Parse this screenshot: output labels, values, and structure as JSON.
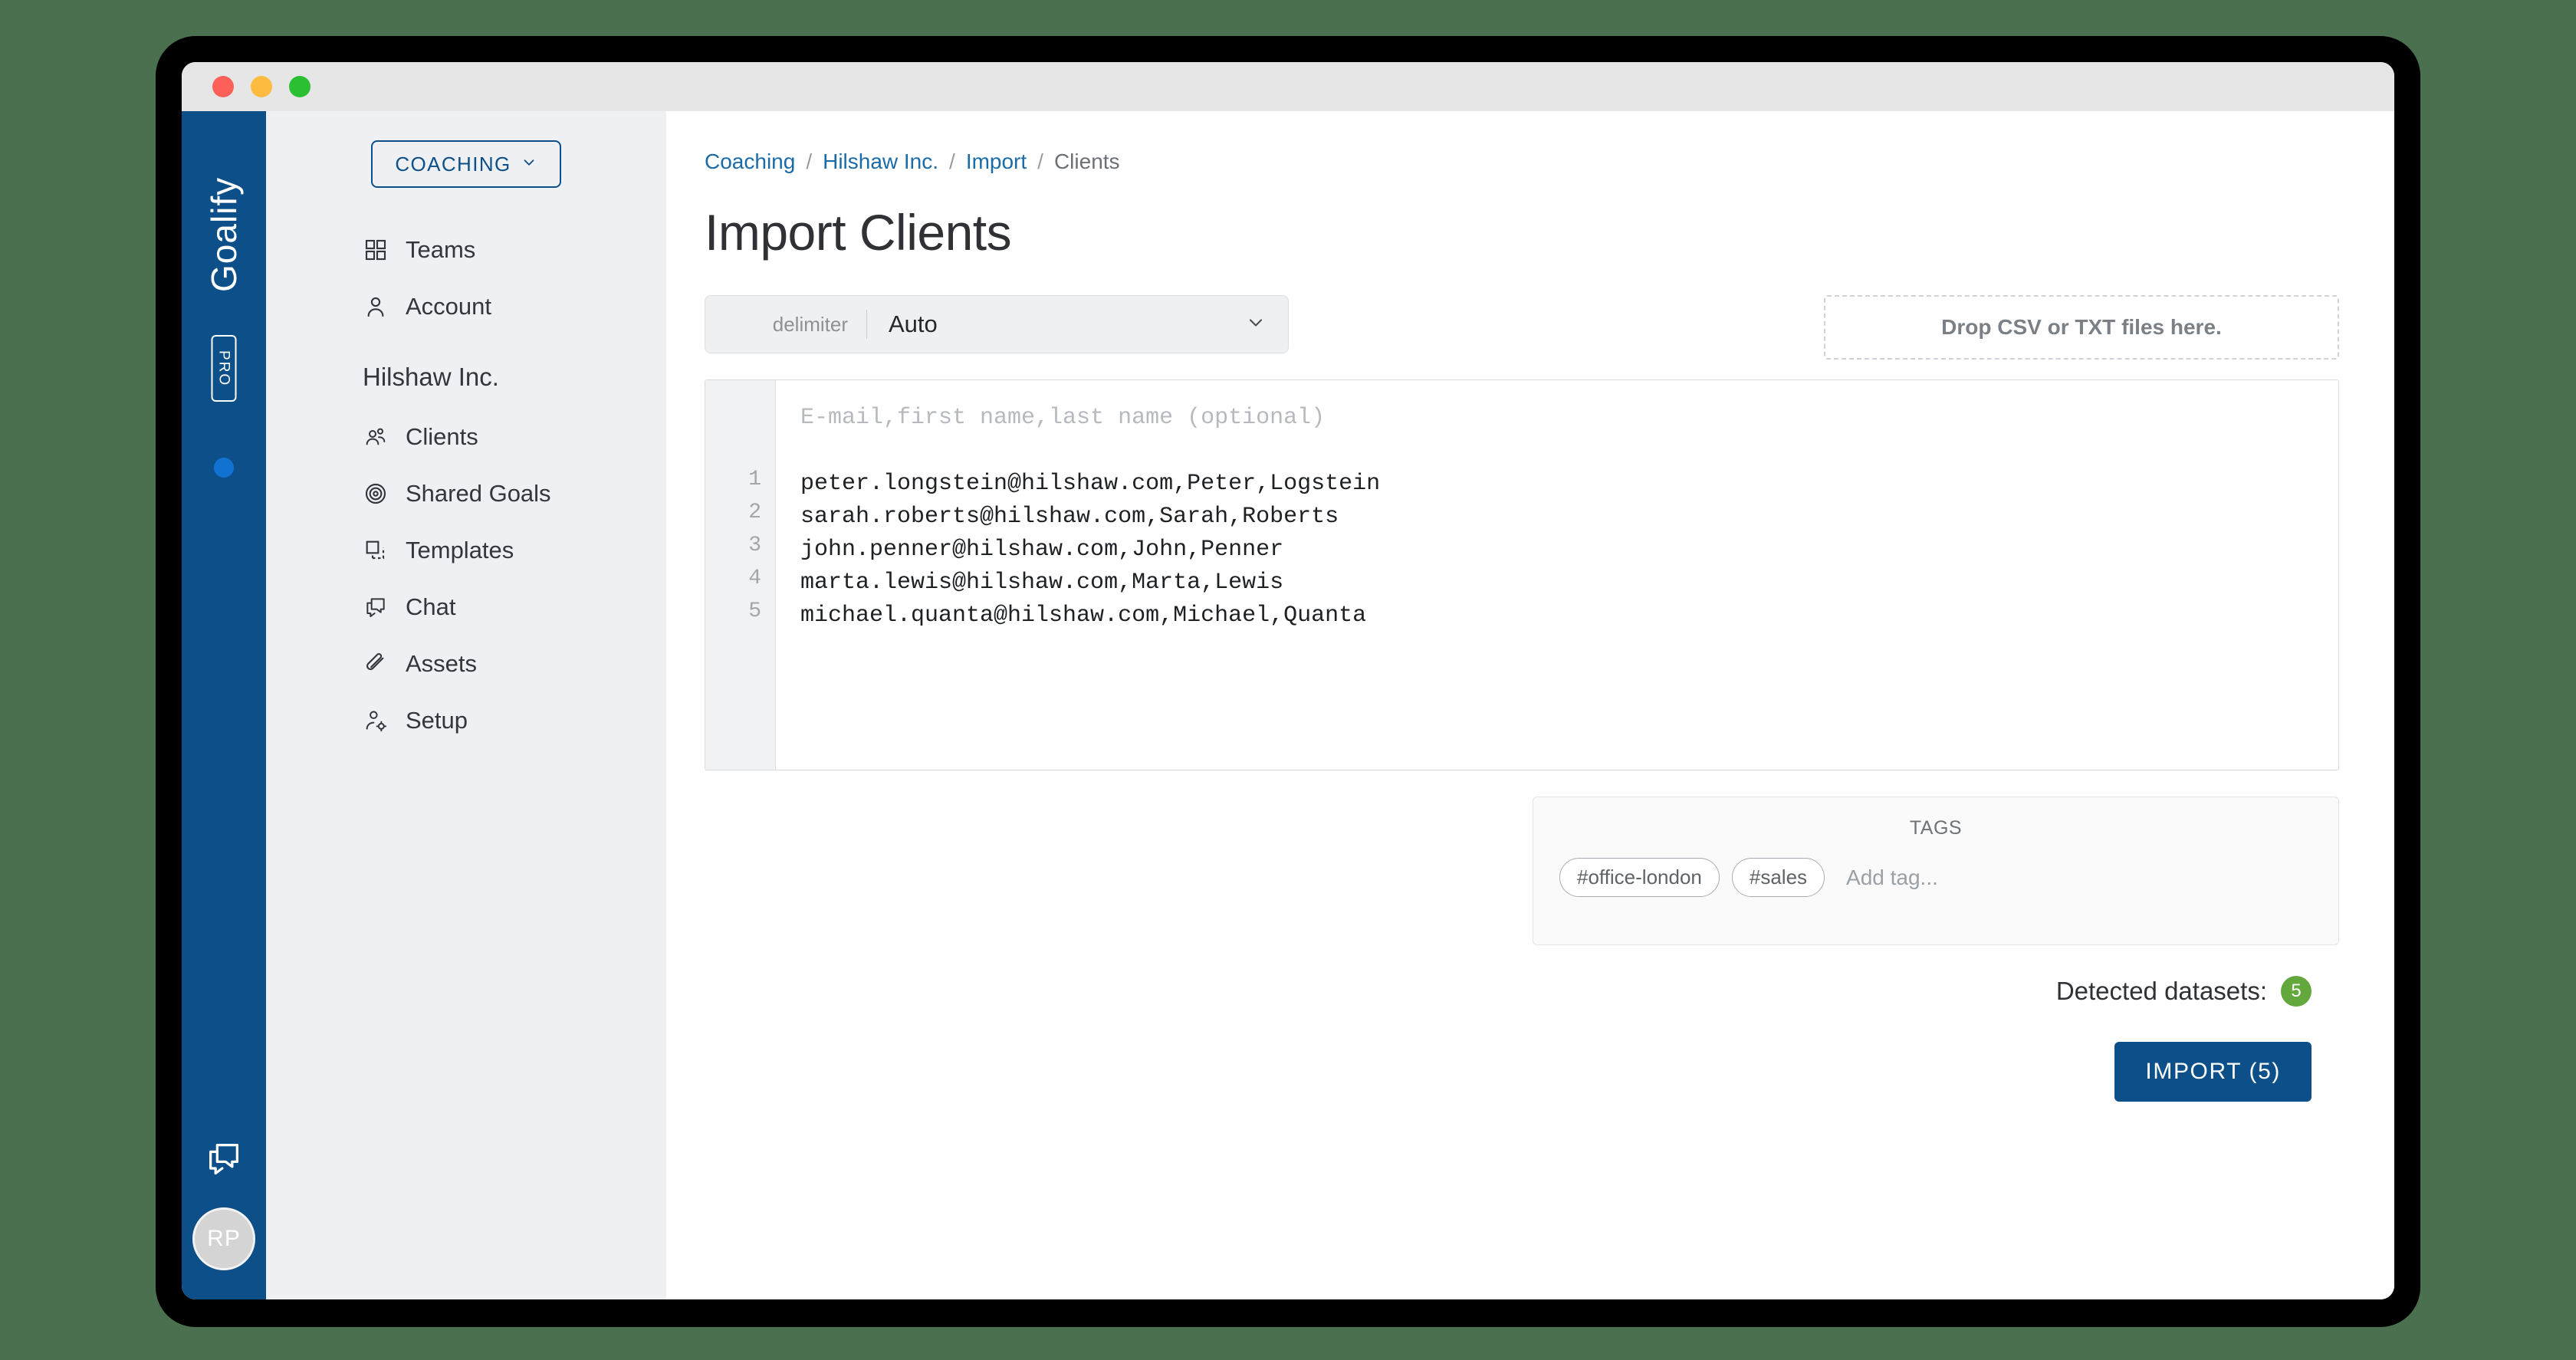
{
  "window": {
    "traffic_lights": [
      "close",
      "minimize",
      "maximize"
    ],
    "colors": {
      "brand_blue": "#0d5089",
      "link_blue": "#1b6ba8",
      "badge_green": "#62a83c",
      "sidebar_bg": "#eef0f3",
      "page_bg": "#4a7050"
    }
  },
  "brand": {
    "wordmark": "Goalify",
    "plan_badge": "PRO",
    "avatar_initials": "RP"
  },
  "sidebar": {
    "workspace_button": "COACHING",
    "workspace_chevron": "chevron-down-icon",
    "top_items": [
      {
        "label": "Teams",
        "icon": "grid-icon"
      },
      {
        "label": "Account",
        "icon": "person-icon"
      }
    ],
    "org_label": "Hilshaw Inc.",
    "org_items": [
      {
        "label": "Clients",
        "icon": "people-icon"
      },
      {
        "label": "Shared Goals",
        "icon": "target-icon"
      },
      {
        "label": "Templates",
        "icon": "copy-icon"
      },
      {
        "label": "Chat",
        "icon": "chat-icon"
      },
      {
        "label": "Assets",
        "icon": "paperclip-icon"
      },
      {
        "label": "Setup",
        "icon": "person-gear-icon"
      }
    ]
  },
  "breadcrumb": {
    "items": [
      "Coaching",
      "Hilshaw Inc.",
      "Import",
      "Clients"
    ],
    "separator": "/"
  },
  "main": {
    "page_title": "Import Clients",
    "delimiter": {
      "label": "delimiter",
      "value": "Auto",
      "chevron": "chevron-down-icon"
    },
    "dropzone": {
      "text": "Drop CSV or TXT files here."
    },
    "editor": {
      "hint": "E-mail,first name,last name (optional)",
      "line_numbers": [
        "1",
        "2",
        "3",
        "4",
        "5"
      ],
      "lines": [
        "peter.longstein@hilshaw.com,Peter,Logstein",
        "sarah.roberts@hilshaw.com,Sarah,Roberts",
        "john.penner@hilshaw.com,John,Penner",
        "marta.lewis@hilshaw.com,Marta,Lewis",
        "michael.quanta@hilshaw.com,Michael,Quanta"
      ]
    },
    "tags": {
      "title": "TAGS",
      "chips": [
        "#office-london",
        "#sales"
      ],
      "input_placeholder": "Add tag..."
    },
    "detected": {
      "label": "Detected datasets:",
      "count": "5"
    },
    "import_button": "IMPORT (5)"
  }
}
